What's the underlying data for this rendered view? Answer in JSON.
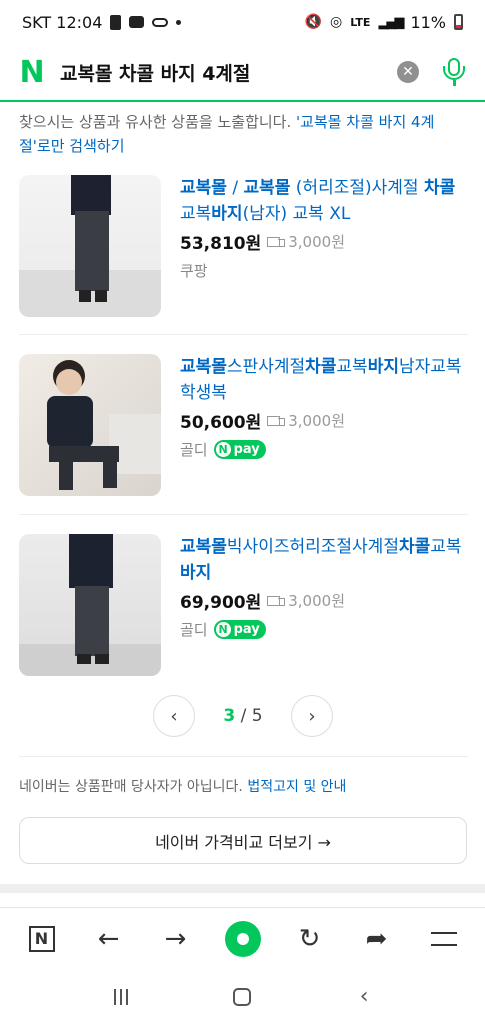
{
  "status_bar": {
    "carrier_time": "SKT 12:04",
    "battery": "11%"
  },
  "search": {
    "logo": "N",
    "query": "교복몰 차콜 바지 4계절"
  },
  "notice": {
    "text": "찾으시는 상품과 유사한 상품을 노출합니다. ",
    "link": "'교복몰 차콜 바지 4계절'로만 검색하기"
  },
  "products": [
    {
      "title": "교복몰 / 교복몰 (허리조절)사계절 차콜 교복바지(남자) 교복 XL",
      "price": "53,810원",
      "shipping": "3,000원",
      "store": "쿠팡",
      "npay": false
    },
    {
      "title": "교복몰스판사계절차콜교복바지남자교복학생복",
      "price": "50,600원",
      "shipping": "3,000원",
      "store": "골디",
      "npay": true
    },
    {
      "title": "교복몰빅사이즈허리조절사계절차콜교복바지",
      "price": "69,900원",
      "shipping": "3,000원",
      "store": "골디",
      "npay": true
    }
  ],
  "npay_label": "pay",
  "pagination": {
    "current": "3",
    "sep": " / ",
    "total": "5"
  },
  "disclaimer": {
    "text": "네이버는 상품판매 당사자가 아닙니다. ",
    "link": "법적고지 및 안내"
  },
  "more_button": "네이버 가격비교 더보기 →",
  "toolbar": {
    "n_label": "N"
  },
  "colors": {
    "brand_green": "#03c75a",
    "link_blue": "#0068c3"
  }
}
